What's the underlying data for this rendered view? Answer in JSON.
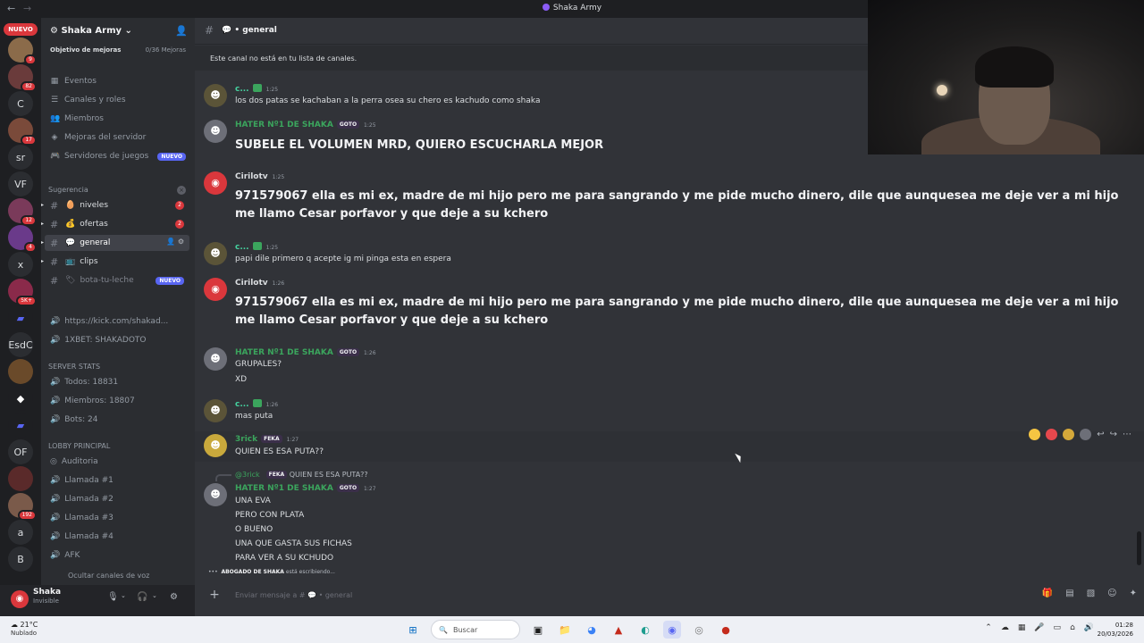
{
  "window": {
    "title": "Shaka Army"
  },
  "server_rail": {
    "nuevo": "NUEVO",
    "items": [
      {
        "label": "",
        "badge": "9"
      },
      {
        "label": "",
        "badge": "82"
      },
      {
        "label": "C",
        "badge": ""
      },
      {
        "label": "",
        "badge": "17"
      },
      {
        "label": "sr",
        "badge": ""
      },
      {
        "label": "VF",
        "badge": ""
      },
      {
        "label": "",
        "badge": "12"
      },
      {
        "label": "",
        "badge": "4"
      },
      {
        "label": "x",
        "badge": ""
      },
      {
        "label": "",
        "badge": "5K+"
      },
      {
        "label": "",
        "badge": ""
      },
      {
        "label": "EsdC",
        "badge": ""
      },
      {
        "label": "",
        "badge": ""
      },
      {
        "label": "",
        "badge": ""
      },
      {
        "label": "",
        "badge": ""
      },
      {
        "label": "OF",
        "badge": ""
      },
      {
        "label": "",
        "badge": ""
      },
      {
        "label": "",
        "badge": "192"
      },
      {
        "label": "a",
        "badge": ""
      },
      {
        "label": "B",
        "badge": ""
      }
    ]
  },
  "sidebar": {
    "guild_name": "Shaka Army",
    "boost_goal": "Objetivo de mejoras",
    "boost_count": "0/36 Mejoras",
    "nav": [
      {
        "label": "Eventos",
        "icon": "calendar-icon"
      },
      {
        "label": "Canales y roles",
        "icon": "list-icon"
      },
      {
        "label": "Miembros",
        "icon": "members-icon"
      },
      {
        "label": "Mejoras del servidor",
        "icon": "boost-icon"
      },
      {
        "label": "Servidores de juegos",
        "icon": "game-icon",
        "tag": "NUEVO"
      }
    ],
    "category1": "Sugerencia",
    "channels": [
      {
        "label": "niveles",
        "count": "2"
      },
      {
        "label": "ofertas",
        "count": "2"
      },
      {
        "label": "general",
        "count": ""
      },
      {
        "label": "clips",
        "count": ""
      },
      {
        "label": "bota-tu-leche",
        "count": "",
        "tag": "NUEVO"
      }
    ],
    "links": [
      "https://kick.com/shakad...",
      "1XBET: SHAKADOTO"
    ],
    "stats_title": "SERVER STATS",
    "stats": [
      "Todos: 18831",
      "Miembros: 18807",
      "Bots: 24"
    ],
    "lobby_title": "LOBBY PRINCIPAL",
    "voice": [
      "Auditoria",
      "Llamada #1",
      "Llamada #2",
      "Llamada #3",
      "Llamada #4",
      "AFK",
      "Ocultar canales de voz"
    ]
  },
  "user": {
    "name": "Shaka",
    "status": "Invisible"
  },
  "chat": {
    "channel": "general",
    "notice": "Este canal no está en tu lista de canales.",
    "composer_placeholder": "Enviar mensaje a #",
    "composer_channel": "general",
    "typing_user": "ABOGADO DE SHAKA",
    "typing_text": "está escribiendo...",
    "messages": [
      {
        "author": "c...",
        "tag": "",
        "time": "1:25",
        "lines": [
          "los dos patas se kachaban a la perra osea su chero es kachudo como shaka"
        ]
      },
      {
        "author": "HATER Nº1 DE SHAKA",
        "tag": "GOTO",
        "time": "1:25",
        "lines": [
          "SUBELE EL VOLUMEN MRD, QUIERO ESCUCHARLA MEJOR"
        ]
      },
      {
        "author": "Cirilotv",
        "tag": "",
        "time": "1:25",
        "lines": [
          "971579067 ella es mi ex, madre de mi hijo pero me para sangrando y me pide mucho dinero, dile que aunquesea me deje ver a mi hijo me llamo Cesar porfavor y que deje a su kchero"
        ]
      },
      {
        "author": "c...",
        "tag": "",
        "time": "1:25",
        "lines": [
          "papi dile primero q acepte ig mi pinga esta en espera"
        ]
      },
      {
        "author": "Cirilotv",
        "tag": "",
        "time": "1:26",
        "lines": [
          "971579067 ella es mi ex, madre de mi hijo pero me para sangrando y me pide mucho dinero, dile que aunquesea me deje ver a mi hijo me llamo Cesar porfavor y que deje a su kchero"
        ]
      },
      {
        "author": "HATER Nº1 DE SHAKA",
        "tag": "GOTO",
        "time": "1:26",
        "lines": [
          "GRUPALES?",
          "XD"
        ]
      },
      {
        "author": "c...",
        "tag": "",
        "time": "1:26",
        "lines": [
          "mas puta"
        ]
      },
      {
        "author": "3rick",
        "tag": "FEKA",
        "time": "1:27",
        "lines": [
          "QUIEN ES ESA PUTA??"
        ]
      },
      {
        "author": "HATER Nº1 DE SHAKA",
        "tag": "GOTO",
        "time": "1:27",
        "reply_author": "@3rick",
        "reply_tag": "FEKA",
        "reply_text": "QUIEN ES ESA PUTA??",
        "lines": [
          "UNA EVA",
          "PERO CON PLATA",
          "O BUENO",
          "UNA QUE GASTA SUS FICHAS",
          "PARA VER A SU KCHUDO"
        ]
      }
    ]
  },
  "taskbar": {
    "weather_temp": "21°C",
    "weather_desc": "Nublado",
    "search_label": "Buscar",
    "time": "01:28",
    "date": "20/03/2026"
  },
  "colors": {
    "accent": "#5865f2",
    "green_name": "#3ba55d",
    "red_badge": "#da373c"
  }
}
